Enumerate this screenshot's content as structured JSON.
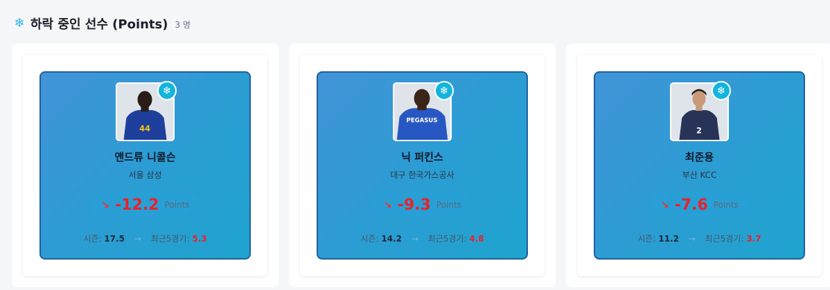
{
  "header": {
    "icon": "snowflake-icon",
    "title": "하락 중인 선수 (Points)",
    "count": "3 명"
  },
  "players": [
    {
      "name": "앤드류 니콜슨",
      "team": "서울 삼성",
      "delta": "-12.2",
      "unit": "Points",
      "season_label": "시즌:",
      "season_value": "17.5",
      "arrow": "→",
      "recent_label": "최근5경기:",
      "recent_value": "5.3",
      "jersey_color": "#1e3f9b"
    },
    {
      "name": "닉 퍼킨스",
      "team": "대구 한국가스공사",
      "delta": "-9.3",
      "unit": "Points",
      "season_label": "시즌:",
      "season_value": "14.2",
      "arrow": "→",
      "recent_label": "최근5경기:",
      "recent_value": "4.8",
      "jersey_color": "#2757c2"
    },
    {
      "name": "최준용",
      "team": "부산 KCC",
      "delta": "-7.6",
      "unit": "Points",
      "season_label": "시즌:",
      "season_value": "11.2",
      "arrow": "→",
      "recent_label": "최근5경기:",
      "recent_value": "3.7",
      "jersey_color": "#283457"
    }
  ],
  "colors": {
    "card_gradient_start": "#4294d8",
    "card_gradient_end": "#1fa4cf",
    "card_border": "#1f5f9c",
    "negative": "#e8222a",
    "badge": "#13b5de"
  }
}
